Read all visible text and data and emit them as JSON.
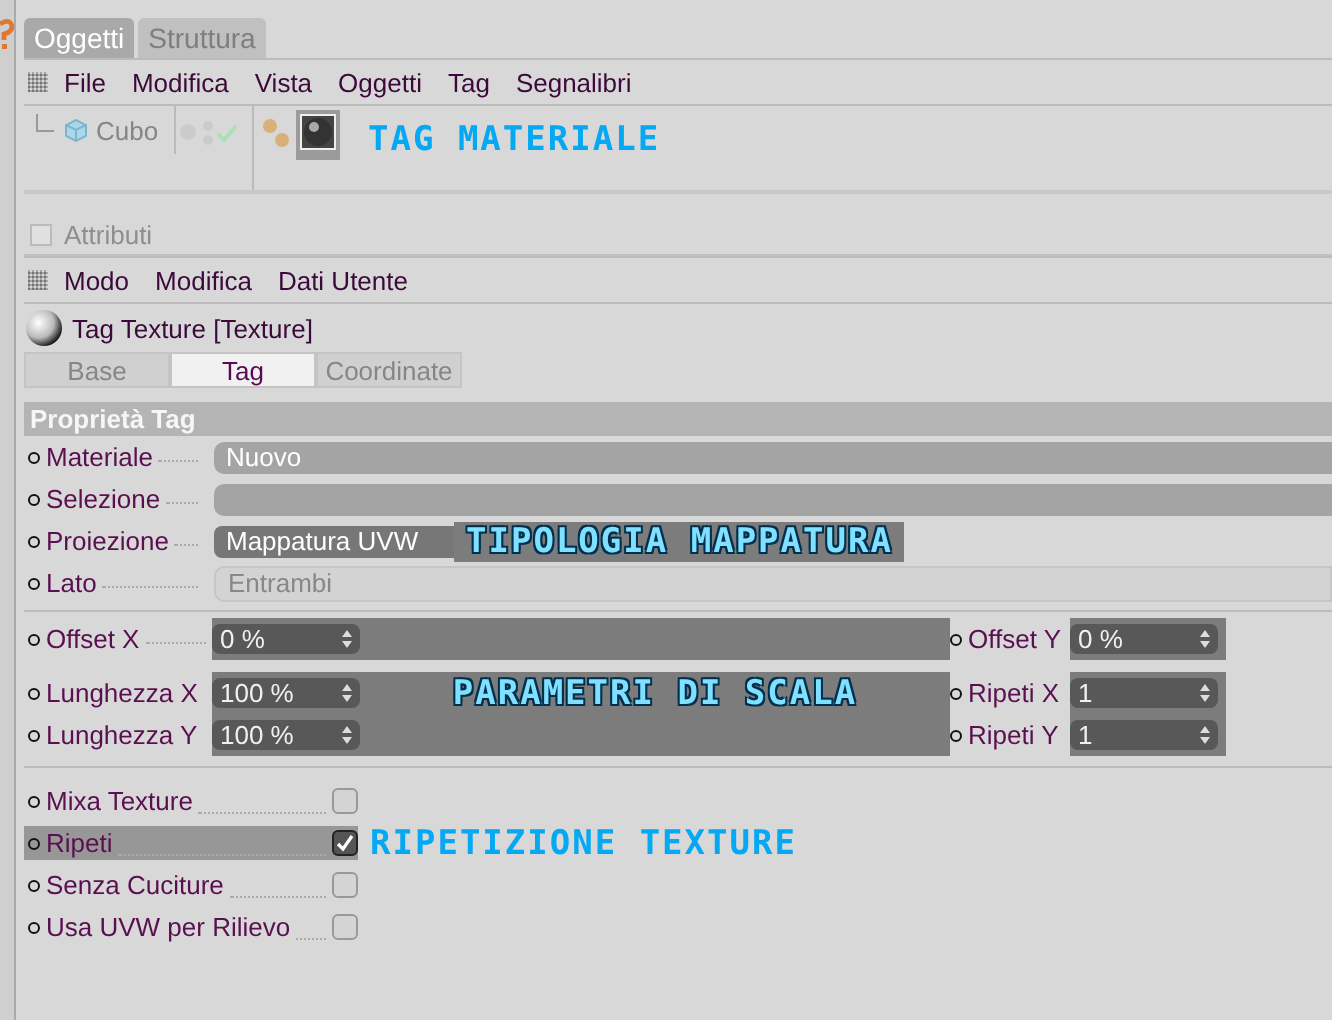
{
  "object_manager": {
    "tabs": [
      {
        "label": "Oggetti",
        "selected": true
      },
      {
        "label": "Struttura",
        "selected": false
      }
    ],
    "menu": [
      "File",
      "Modifica",
      "Vista",
      "Oggetti",
      "Tag",
      "Segnalibri"
    ],
    "object": {
      "name": "Cubo"
    },
    "annotation": "TAG MATERIALE"
  },
  "attribute_manager": {
    "title": "Attributi",
    "menu": [
      "Modo",
      "Modifica",
      "Dati Utente"
    ],
    "heading": "Tag Texture [Texture]",
    "tabs": [
      {
        "label": "Base",
        "selected": false
      },
      {
        "label": "Tag",
        "selected": true
      },
      {
        "label": "Coordinate",
        "selected": false
      }
    ],
    "section": "Proprietà Tag",
    "params": [
      {
        "label": "Materiale",
        "value": "Nuovo",
        "disabled": false,
        "highlighted": false
      },
      {
        "label": "Selezione",
        "disabled": false,
        "highlighted": false
      },
      {
        "label": "Proiezione",
        "value": "Mappatura UVW",
        "disabled": false,
        "highlighted": true
      },
      {
        "label": "Lato",
        "value": "Entrambi",
        "disabled": true,
        "highlighted": false
      }
    ],
    "projection_annotation": "TIPOLOGIA MAPPATURA",
    "numeric_rows": [
      {
        "left": {
          "label": "Offset X",
          "value": "0 %"
        },
        "right": {
          "label": "Offset Y",
          "value": "0 %"
        }
      },
      {
        "left": {
          "label": "Lunghezza X",
          "value": "100 %"
        },
        "right": {
          "label": "Ripeti X",
          "value": "1"
        }
      },
      {
        "left": {
          "label": "Lunghezza Y",
          "value": "100 %"
        },
        "right": {
          "label": "Ripeti Y",
          "value": "1"
        }
      }
    ],
    "scale_annotation": "PARAMETRI DI SCALA",
    "options": [
      {
        "label": "Mixa Texture",
        "checked": false,
        "highlighted": false
      },
      {
        "label": "Ripeti",
        "checked": true,
        "highlighted": true
      },
      {
        "label": "Senza Cuciture",
        "checked": false,
        "highlighted": false
      },
      {
        "label": "Usa UVW per Rilievo",
        "checked": false,
        "highlighted": false
      }
    ],
    "repeat_annotation": "RIPETIZIONE TEXTURE"
  }
}
